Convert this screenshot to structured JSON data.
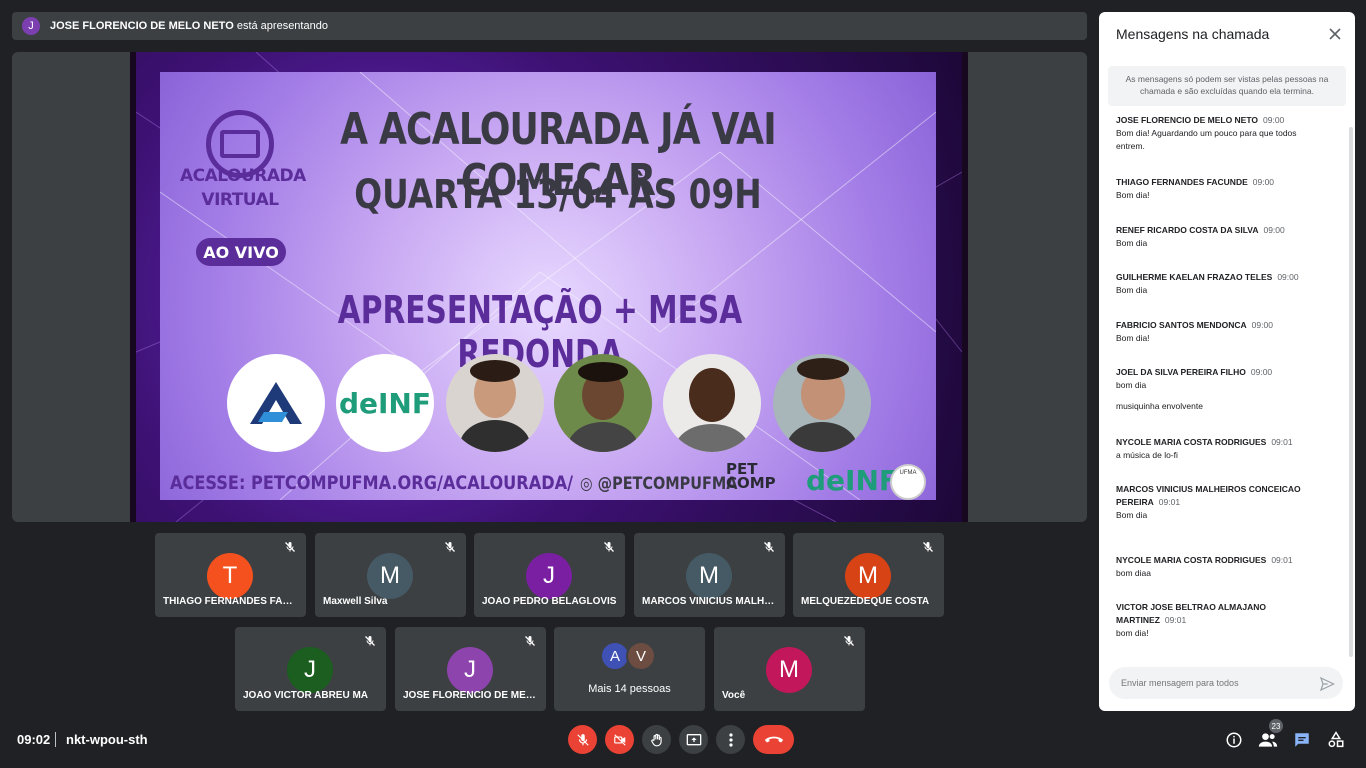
{
  "presenter": {
    "initial": "J",
    "name": "JOSE FLORENCIO DE MELO NETO",
    "suffix": "está apresentando"
  },
  "slide": {
    "logo_line1": "ACALOURADA",
    "logo_line2": "VIRTUAL",
    "logo_badge": "AO VIVO",
    "title1": "A ACALOURADA JÁ VAI COMEÇAR",
    "title2": "QUARTA 13/04 ÀS 09H",
    "title3": "APRESENTAÇÃO + MESA REDONDA",
    "badge_delnf": "deINF",
    "url": "ACESSE: PETCOMPUFMA.ORG/ACALOURADA/",
    "instagram": "@PETCOMPUFMA",
    "pet_line1": "PET",
    "pet_line2": "COMP",
    "footer_delnf": "deINF",
    "ufma": "UFMA"
  },
  "tiles": [
    {
      "initial": "T",
      "name": "THIAGO FERNANDES FACUNDE",
      "color": "#f4511e"
    },
    {
      "initial": "M",
      "name": "Maxwell Silva",
      "color": "#455a64"
    },
    {
      "initial": "J",
      "name": "JOAO PEDRO BELAGLOVIS",
      "color": "#7b1fa2"
    },
    {
      "initial": "M",
      "name": "MARCOS VINICIUS MALHEIROS",
      "color": "#455a64"
    },
    {
      "initial": "M",
      "name": "MELQUEZEDEQUE COSTA",
      "color": "#d84315"
    },
    {
      "initial": "J",
      "name": "JOAO VICTOR ABREU MA",
      "color": "#1b5e20"
    },
    {
      "initial": "J",
      "name": "JOSE FLORENCIO DE MELO",
      "color": "#8e44ad"
    },
    {
      "initial": "M",
      "name": "Você",
      "color": "#c2185b"
    }
  ],
  "more": {
    "initials": [
      "A",
      "V"
    ],
    "colors": [
      "#3f51b5",
      "#6d4c41"
    ],
    "label": "Mais 14 pessoas"
  },
  "meeting": {
    "time": "09:02",
    "code": "nkt-wpou-sth",
    "people_count": "23"
  },
  "chat": {
    "title": "Mensagens na chamada",
    "notice": "As mensagens só podem ser vistas pelas pessoas na chamada e são excluídas quando ela termina.",
    "input_placeholder": "Enviar mensagem para todos",
    "messages": [
      {
        "sender": "JOSE FLORENCIO DE MELO NETO",
        "time": "09:00",
        "text": "Bom dia! Aguardando um pouco para que todos entrem."
      },
      {
        "sender": "THIAGO FERNANDES FACUNDE",
        "time": "09:00",
        "text": "Bom dia!"
      },
      {
        "sender": "RENEF RICARDO COSTA DA SILVA",
        "time": "09:00",
        "text": "Bom dia"
      },
      {
        "sender": "GUILHERME KAELAN FRAZAO TELES",
        "time": "09:00",
        "text": "Bom dia"
      },
      {
        "sender": "FABRICIO SANTOS MENDONCA",
        "time": "09:00",
        "text": "Bom dia!"
      },
      {
        "sender": "JOEL DA SILVA PEREIRA FILHO",
        "time": "09:00",
        "text": "bom dia",
        "extra": "musiquinha envolvente"
      },
      {
        "sender": "NYCOLE MARIA COSTA RODRIGUES",
        "time": "09:01",
        "text": "a música de lo-fi"
      },
      {
        "sender": "MARCOS VINICIUS MALHEIROS CONCEICAO PEREIRA",
        "time": "09:01",
        "text": "Bom dia"
      },
      {
        "sender": "NYCOLE MARIA COSTA RODRIGUES",
        "time": "09:01",
        "text": "bom diaa"
      },
      {
        "sender": "VICTOR JOSE BELTRAO ALMAJANO MARTINEZ",
        "time": "09:01",
        "text": "bom dia!"
      }
    ]
  }
}
